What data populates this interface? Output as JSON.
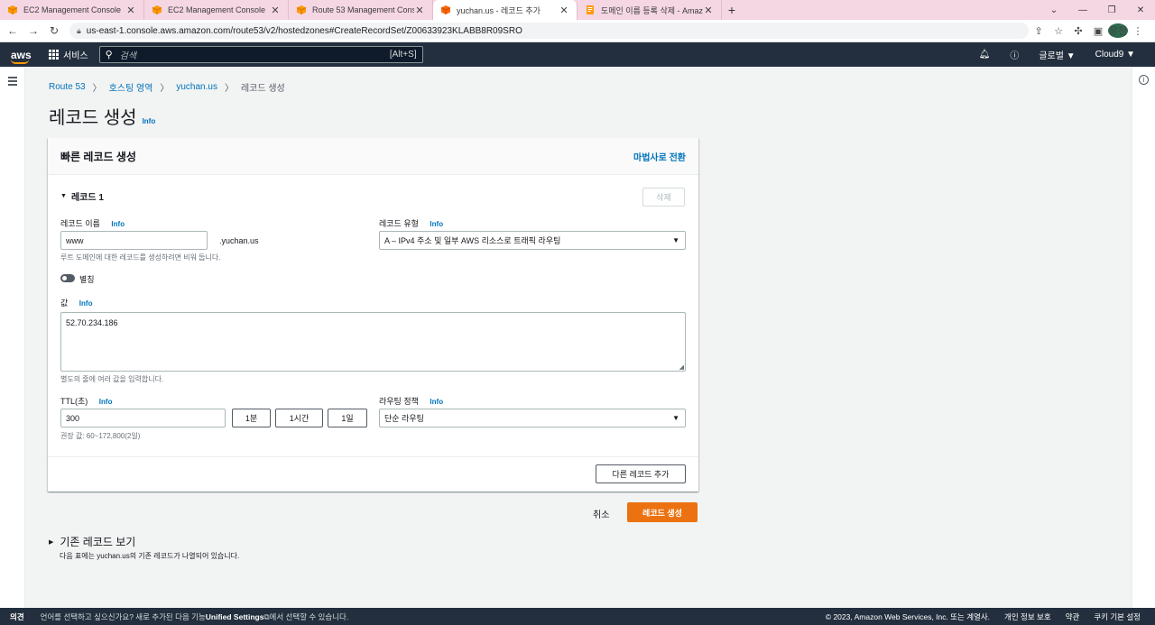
{
  "browser": {
    "tabs": [
      {
        "title": "EC2 Management Console",
        "active": false
      },
      {
        "title": "EC2 Management Console",
        "active": false
      },
      {
        "title": "Route 53 Management Console",
        "active": false
      },
      {
        "title": "yuchan.us - 레코드 추가",
        "active": true
      },
      {
        "title": "도메인 이름 등록 삭제 - Amazon",
        "active": false
      }
    ],
    "url": "us-east-1.console.aws.amazon.com/route53/v2/hostedzones#CreateRecordSet/Z00633923KLABB8R09SRO",
    "profile": "유찬"
  },
  "aws_header": {
    "logo": "aws",
    "services": "서비스",
    "search_placeholder": "검색",
    "search_shortcut": "[Alt+S]",
    "region": "글로벌 ▼",
    "account": "Cloud9 ▼"
  },
  "breadcrumb": [
    "Route 53",
    "호스팅 영역",
    "yuchan.us",
    "레코드 생성"
  ],
  "page": {
    "title": "레코드 생성",
    "info": "Info"
  },
  "panel": {
    "heading": "빠른 레코드 생성",
    "wizard_link": "마법사로 전환",
    "record_section": "레코드 1",
    "delete_label": "삭제",
    "record_name": {
      "label": "레코드 이름",
      "info": "Info",
      "value": "www",
      "suffix": ".yuchan.us",
      "hint": "루트 도메인에 대한 레코드를 생성하려면 비워 둡니다."
    },
    "record_type": {
      "label": "레코드 유형",
      "info": "Info",
      "value": "A – IPv4 주소 및 일부 AWS 리소스로 트래픽 라우팅"
    },
    "alias_label": "별칭",
    "value_field": {
      "label": "값",
      "info": "Info",
      "value": "52.70.234.186",
      "hint": "별도의 줄에 여러 값을 입력합니다."
    },
    "ttl": {
      "label": "TTL(초)",
      "info": "Info",
      "value": "300",
      "hint": "권장 값: 60~172,800(2일)",
      "presets": [
        "1분",
        "1시간",
        "1일"
      ]
    },
    "routing_policy": {
      "label": "라우팅 정책",
      "info": "Info",
      "value": "단순 라우팅"
    },
    "add_record_label": "다른 레코드 추가"
  },
  "actions": {
    "cancel": "취소",
    "create": "레코드 생성"
  },
  "existing": {
    "title": "기존 레코드 보기",
    "desc": "다음 표에는 yuchan.us의 기존 레코드가 나열되어 있습니다."
  },
  "footer": {
    "feedback": "의견",
    "lang_prefix": "언어를 선택하고 싶으신가요? 새로 추가된 다음 기능",
    "lang_feature": "Unified Settings",
    "lang_suffix": "에서 선택할 수 있습니다.",
    "copyright": "© 2023, Amazon Web Services, Inc. 또는 계열사.",
    "privacy": "개인 정보 보호",
    "terms": "약관",
    "cookies": "쿠키 기본 설정"
  }
}
